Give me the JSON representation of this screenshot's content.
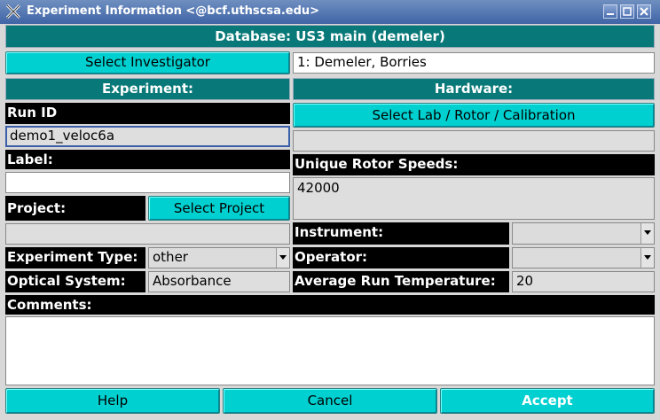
{
  "window": {
    "title": "Experiment Information <@bcf.uthscsa.edu>"
  },
  "header": {
    "database": "Database: US3 main (demeler)"
  },
  "investigator": {
    "button_label": "Select Investigator",
    "value": "1: Demeler, Borries"
  },
  "experiment": {
    "section_label": "Experiment:",
    "run_id_label": "Run ID",
    "run_id_value": "demo1_veloc6a",
    "label_label": "Label:",
    "label_value": "",
    "project_label": "Project:",
    "project_button": "Select Project",
    "project_value": "",
    "type_label": "Experiment Type:",
    "type_value": "other",
    "optical_label": "Optical System:",
    "optical_value": "Absorbance"
  },
  "hardware": {
    "section_label": "Hardware:",
    "select_button": "Select Lab / Rotor / Calibration",
    "lab_value": "",
    "rotor_speeds_label": "Unique Rotor Speeds:",
    "rotor_speeds_value": "42000",
    "instrument_label": "Instrument:",
    "instrument_value": "",
    "operator_label": "Operator:",
    "operator_value": "",
    "avg_temp_label": "Average Run Temperature:",
    "avg_temp_value": "20"
  },
  "comments": {
    "label": "Comments:",
    "value": ""
  },
  "footer": {
    "help": "Help",
    "cancel": "Cancel",
    "accept": "Accept"
  },
  "colors": {
    "teal_bar": "#087878",
    "cyan_button": "#00d0d0",
    "label_bg": "#000000",
    "titlebar": "#4b6fb0"
  }
}
